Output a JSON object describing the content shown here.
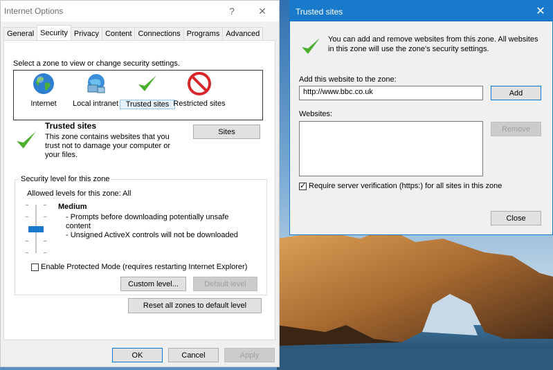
{
  "internet_options": {
    "title": "Internet Options",
    "help_glyph": "?",
    "close_glyph": "✕",
    "tabs": [
      "General",
      "Security",
      "Privacy",
      "Content",
      "Connections",
      "Programs",
      "Advanced"
    ],
    "active_tab": "Security",
    "zone_prompt": "Select a zone to view or change security settings.",
    "zones": [
      {
        "label": "Internet",
        "icon": "globe-icon"
      },
      {
        "label": "Local intranet",
        "icon": "network-icon"
      },
      {
        "label": "Trusted sites",
        "icon": "checkmark-icon"
      },
      {
        "label": "Restricted sites",
        "icon": "no-entry-icon"
      }
    ],
    "selected_zone": "Trusted sites",
    "zone_info": {
      "heading": "Trusted sites",
      "description": "This zone contains websites that you trust not to damage your computer or your files."
    },
    "sites_button": "Sites",
    "security_level": {
      "group_title": "Security level for this zone",
      "allowed_levels": "Allowed levels for this zone: All",
      "level_name": "Medium",
      "bullets": [
        "- Prompts before downloading potentially unsafe content",
        "- Unsigned ActiveX controls will not be downloaded"
      ],
      "protected_mode_label": "Enable Protected Mode (requires restarting Internet Explorer)",
      "protected_mode_checked": false,
      "custom_level_button": "Custom level...",
      "default_level_button": "Default level"
    },
    "reset_button": "Reset all zones to default level",
    "ok_button": "OK",
    "cancel_button": "Cancel",
    "apply_button": "Apply"
  },
  "trusted_sites": {
    "title": "Trusted sites",
    "close_glyph": "✕",
    "info_text": "You can add and remove websites from this zone. All websites in this zone will use the zone's security settings.",
    "add_label": "Add this website to the zone:",
    "add_value": "http://www.bbc.co.uk",
    "add_button": "Add",
    "websites_label": "Websites:",
    "websites": [],
    "remove_button": "Remove",
    "require_verification_label": "Require server verification (https:) for all sites in this zone",
    "require_verification_checked": true,
    "close_button": "Close"
  },
  "colors": {
    "dialog_accent": "#1979ca",
    "check_green": "#4cae2f",
    "restricted_red": "#d9262b",
    "slider_thumb": "#1979ca"
  }
}
